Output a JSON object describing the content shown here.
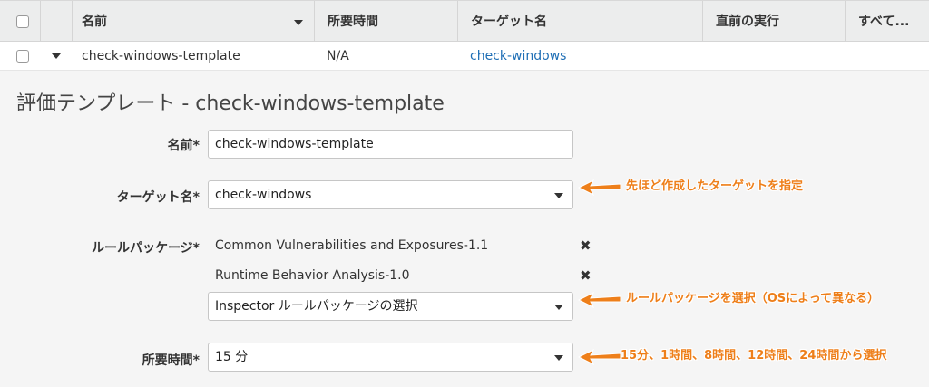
{
  "table": {
    "headers": {
      "name": "名前",
      "duration": "所要時間",
      "target": "ターゲット名",
      "last_run": "直前の実行",
      "all": "すべて..."
    },
    "row": {
      "name": "check-windows-template",
      "duration": "N/A",
      "target": "check-windows"
    }
  },
  "detail": {
    "title": "評価テンプレート - check-windows-template",
    "name_label": "名前*",
    "name_value": "check-windows-template",
    "target_label": "ターゲット名*",
    "target_value": "check-windows",
    "packages_label": "ルールパッケージ*",
    "packages": [
      "Common Vulnerabilities and Exposures-1.1",
      "Runtime Behavior Analysis-1.0"
    ],
    "package_select_placeholder": "Inspector ルールパッケージの選択",
    "duration_label": "所要時間*",
    "duration_value": "15 分"
  },
  "annotations": {
    "target_note": "先ほど作成したターゲットを指定",
    "package_note": "ルールパッケージを選択（OSによって異なる）",
    "duration_note": "15分、1時間、8時間、12時間、24時間から選択"
  },
  "colors": {
    "annotation": "#ee7f1a",
    "link": "#1e6eb5"
  }
}
